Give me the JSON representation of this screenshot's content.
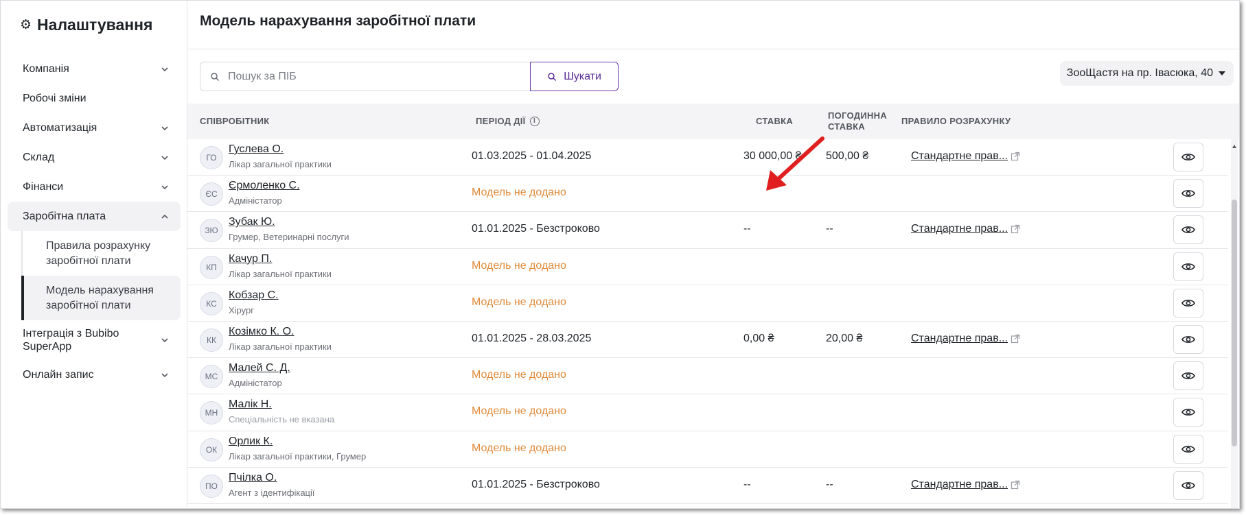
{
  "sidebar": {
    "title": "Налаштування",
    "items": [
      {
        "label": "Компанія",
        "chevron": "down"
      },
      {
        "label": "Робочі зміни",
        "chevron": ""
      },
      {
        "label": "Автоматизація",
        "chevron": "down"
      },
      {
        "label": "Склад",
        "chevron": "down"
      },
      {
        "label": "Фінанси",
        "chevron": "down"
      },
      {
        "label": "Заробітна плата",
        "chevron": "up"
      }
    ],
    "sub_items": [
      {
        "label": "Правила розрахунку заробітної плати"
      },
      {
        "label": "Модель нарахування заробітної плати",
        "active": true
      }
    ],
    "after_items": [
      {
        "label": "Інтеграція з Bubibo SuperApp",
        "chevron": "down"
      },
      {
        "label": "Онлайн запис",
        "chevron": "down"
      }
    ]
  },
  "page": {
    "title": "Модель нарахування заробітної плати"
  },
  "search": {
    "placeholder": "Пошук за ПІБ",
    "value": "",
    "button_label": "Шукати"
  },
  "location": {
    "selected": "ЗооЩастя на пр. Івасюка, 40"
  },
  "table": {
    "columns": {
      "employee": "Співробітник",
      "period": "Період дії",
      "rate": "Ставка",
      "hourly_rate_line1": "Погодинна",
      "hourly_rate_line2": "ставка",
      "rule": "Правило розрахунку"
    },
    "rows": [
      {
        "initials": "ГО",
        "name": "Гуслева О.",
        "role": "Лікар загальної практики",
        "period": "01.03.2025 - 01.04.2025",
        "period_warn": false,
        "rate": "30 000,00 ₴",
        "hourly": "500,00 ₴",
        "rule": "Стандартне прав..."
      },
      {
        "initials": "ЄС",
        "name": "Єрмоленко С.",
        "role": "Адміністатор",
        "period": "Модель не додано",
        "period_warn": true,
        "rate": "",
        "hourly": "",
        "rule": ""
      },
      {
        "initials": "ЗЮ",
        "name": "Зубак Ю.",
        "role": "Грумер, Ветеринарні послуги",
        "period": "01.01.2025 - Безстроково",
        "period_warn": false,
        "rate": "--",
        "hourly": "--",
        "rule": "Стандартне прав..."
      },
      {
        "initials": "КП",
        "name": "Качур П.",
        "role": "Лікар загальної практики",
        "period": "Модель не додано",
        "period_warn": true,
        "rate": "",
        "hourly": "",
        "rule": ""
      },
      {
        "initials": "КС",
        "name": "Кобзар С.",
        "role": "Хірург",
        "period": "Модель не додано",
        "period_warn": true,
        "rate": "",
        "hourly": "",
        "rule": ""
      },
      {
        "initials": "КК",
        "name": "Козімко К. О.",
        "role": "Лікар загальної практики",
        "period": "01.01.2025 - 28.03.2025",
        "period_warn": false,
        "rate": "0,00 ₴",
        "hourly": "20,00 ₴",
        "rule": "Стандартне прав..."
      },
      {
        "initials": "МС",
        "name": "Малей С. Д.",
        "role": "Адміністатор",
        "period": "Модель не додано",
        "period_warn": true,
        "rate": "",
        "hourly": "",
        "rule": ""
      },
      {
        "initials": "МН",
        "name": "Малік Н.",
        "role": "Спеціальність не вказана",
        "role_muted": true,
        "period": "Модель не додано",
        "period_warn": true,
        "rate": "",
        "hourly": "",
        "rule": ""
      },
      {
        "initials": "ОК",
        "name": "Орлик К.",
        "role": "Лікар загальної практики, Грумер",
        "period": "Модель не додано",
        "period_warn": true,
        "rate": "",
        "hourly": "",
        "rule": ""
      },
      {
        "initials": "ПО",
        "name": "Пчілка О.",
        "role": "Агент з ідентифікації",
        "period": "01.01.2025 - Безстроково",
        "period_warn": false,
        "rate": "--",
        "hourly": "--",
        "rule": "Стандартне прав..."
      }
    ]
  },
  "colors": {
    "accent": "#5b2d96",
    "warning": "#e08a3a",
    "annotation_arrow": "#e02020"
  },
  "icons": [
    "gear-icon",
    "chevron-down-icon",
    "chevron-up-icon",
    "search-icon",
    "info-icon",
    "external-link-icon",
    "eye-icon",
    "caret-down-icon",
    "red-arrow-annotation"
  ]
}
